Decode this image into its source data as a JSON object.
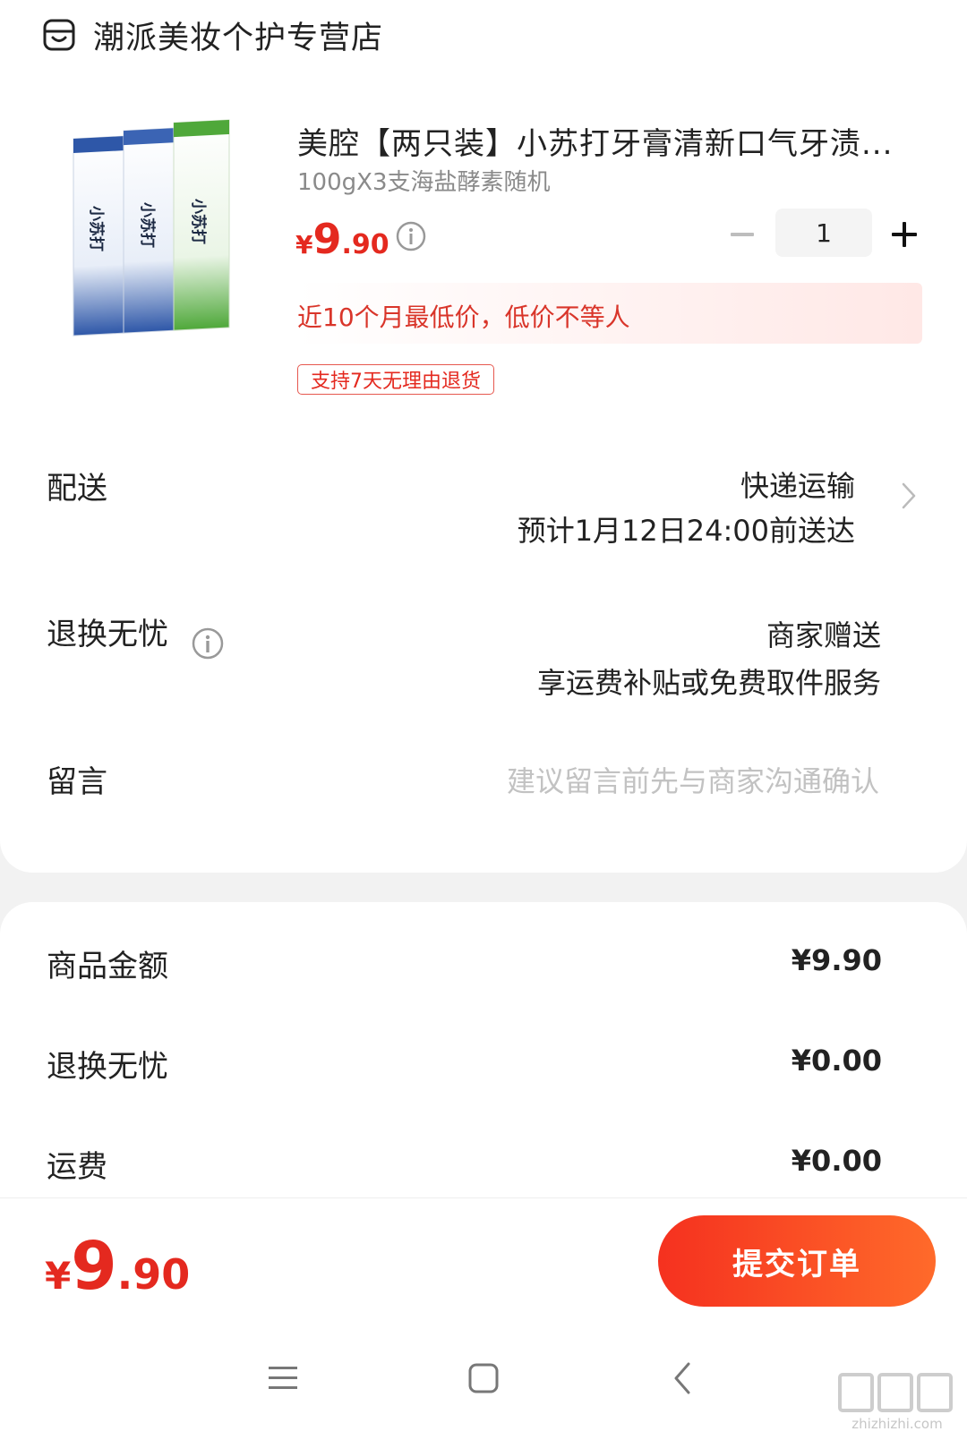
{
  "store": {
    "name": "潮派美妆个护专营店",
    "icon": "store-icon"
  },
  "product": {
    "title": "美腔【两只装】小苏打牙膏清新口气牙渍...",
    "spec": "100gX3支海盐酵素随机",
    "price": {
      "symbol": "¥",
      "int": "9",
      "dec": ".90"
    },
    "quantity": "1",
    "lowest_note": "近10个月最低价，低价不等人",
    "return_tag": "支持7天无理由退货",
    "image_label": "小苏打"
  },
  "delivery": {
    "label": "配送",
    "method": "快递运输",
    "eta": "预计1月12日24:00前送达"
  },
  "return_worry": {
    "label": "退换无忧",
    "value1": "商家赠送",
    "value2": "享运费补贴或免费取件服务"
  },
  "message": {
    "label": "留言",
    "placeholder": "建议留言前先与商家沟通确认"
  },
  "summary": {
    "goods_label": "商品金额",
    "goods_value": "¥9.90",
    "return_label": "退换无忧",
    "return_value": "¥0.00",
    "shipping_label": "运费",
    "shipping_value": "¥0.00"
  },
  "bottom": {
    "total": {
      "symbol": "¥",
      "int": "9",
      "dec": ".90"
    },
    "submit_label": "提交订单"
  },
  "watermark": {
    "site": "zhizhizhi.com",
    "mark": "值值值"
  },
  "colors": {
    "accent": "#e4291f",
    "button_start": "#f5311f",
    "button_end": "#ff6a2a"
  }
}
